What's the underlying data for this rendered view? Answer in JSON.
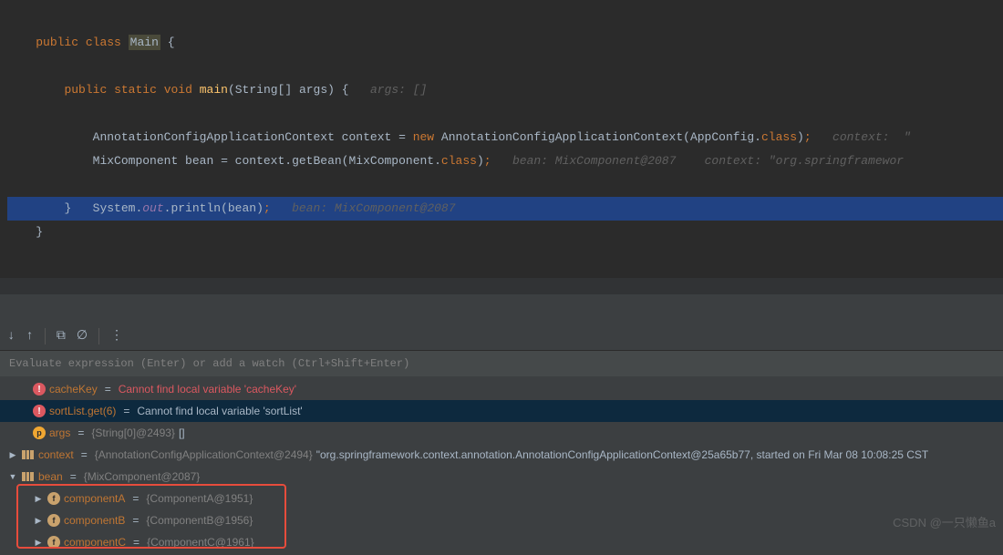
{
  "code": {
    "l1_public": "public",
    "l1_class": "class",
    "l1_main": "Main",
    "l1_brace": "{",
    "l2_public": "public",
    "l2_static": "static",
    "l2_void": "void",
    "l2_main": "main",
    "l2_params": "(String[] args) {",
    "l2_hint": "args: []",
    "l3_text1": "AnnotationConfigApplicationContext context = ",
    "l3_new": "new",
    "l3_text2": " AnnotationConfigApplicationContext(AppConfig",
    "l3_dot": ".",
    "l3_class": "class",
    "l3_text3": ")",
    "l3_semi": ";",
    "l3_hint": "context:  \"",
    "l4_text1": "MixComponent bean = context.getBean(MixComponent",
    "l4_dot": ".",
    "l4_class": "class",
    "l4_text2": ")",
    "l4_semi": ";",
    "l4_hint1": "bean: MixComponent@2087",
    "l4_hint2": "context: \"org.springframewor",
    "l5_text1": "System.",
    "l5_out": "out",
    "l5_text2": ".println(bean)",
    "l5_semi": ";",
    "l5_hint": "bean: MixComponent@2087",
    "l6_brace": "}",
    "l7_brace": "}"
  },
  "watch_input": "Evaluate expression (Enter) or add a watch (Ctrl+Shift+Enter)",
  "vars": {
    "cacheKey_name": "cacheKey",
    "cacheKey_val": "Cannot find local variable 'cacheKey'",
    "sortList_name": "sortList.get(6)",
    "sortList_val": "Cannot find local variable 'sortList'",
    "args_name": "args",
    "args_type": "{String[0]@2493}",
    "args_val": "[]",
    "context_name": "context",
    "context_type": "{AnnotationConfigApplicationContext@2494}",
    "context_val": "\"org.springframework.context.annotation.AnnotationConfigApplicationContext@25a65b77, started on Fri Mar 08 10:08:25 CST",
    "bean_name": "bean",
    "bean_type": "{MixComponent@2087}",
    "compA_name": "componentA",
    "compA_type": "{ComponentA@1951}",
    "compB_name": "componentB",
    "compB_type": "{ComponentB@1956}",
    "compC_name": "componentC",
    "compC_type": "{ComponentC@1961}"
  },
  "watermark": "CSDN @一只懒鱼a",
  "badges": {
    "error": "!",
    "param": "p",
    "field": "f"
  }
}
